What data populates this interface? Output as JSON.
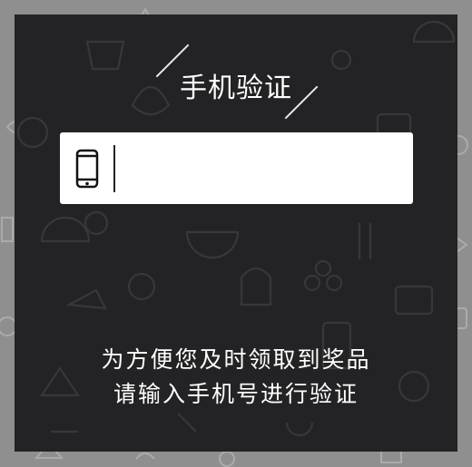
{
  "header": {
    "title": "手机验证"
  },
  "form": {
    "phone_value": "",
    "phone_icon": "mobile-phone-icon"
  },
  "message": {
    "line1": "为方便您及时领取到奖品",
    "line2": "请输入手机号进行验证"
  },
  "colors": {
    "panel": "#232325",
    "outer": "#8f8f8f",
    "text": "#ffffff",
    "input_bg": "#ffffff"
  }
}
